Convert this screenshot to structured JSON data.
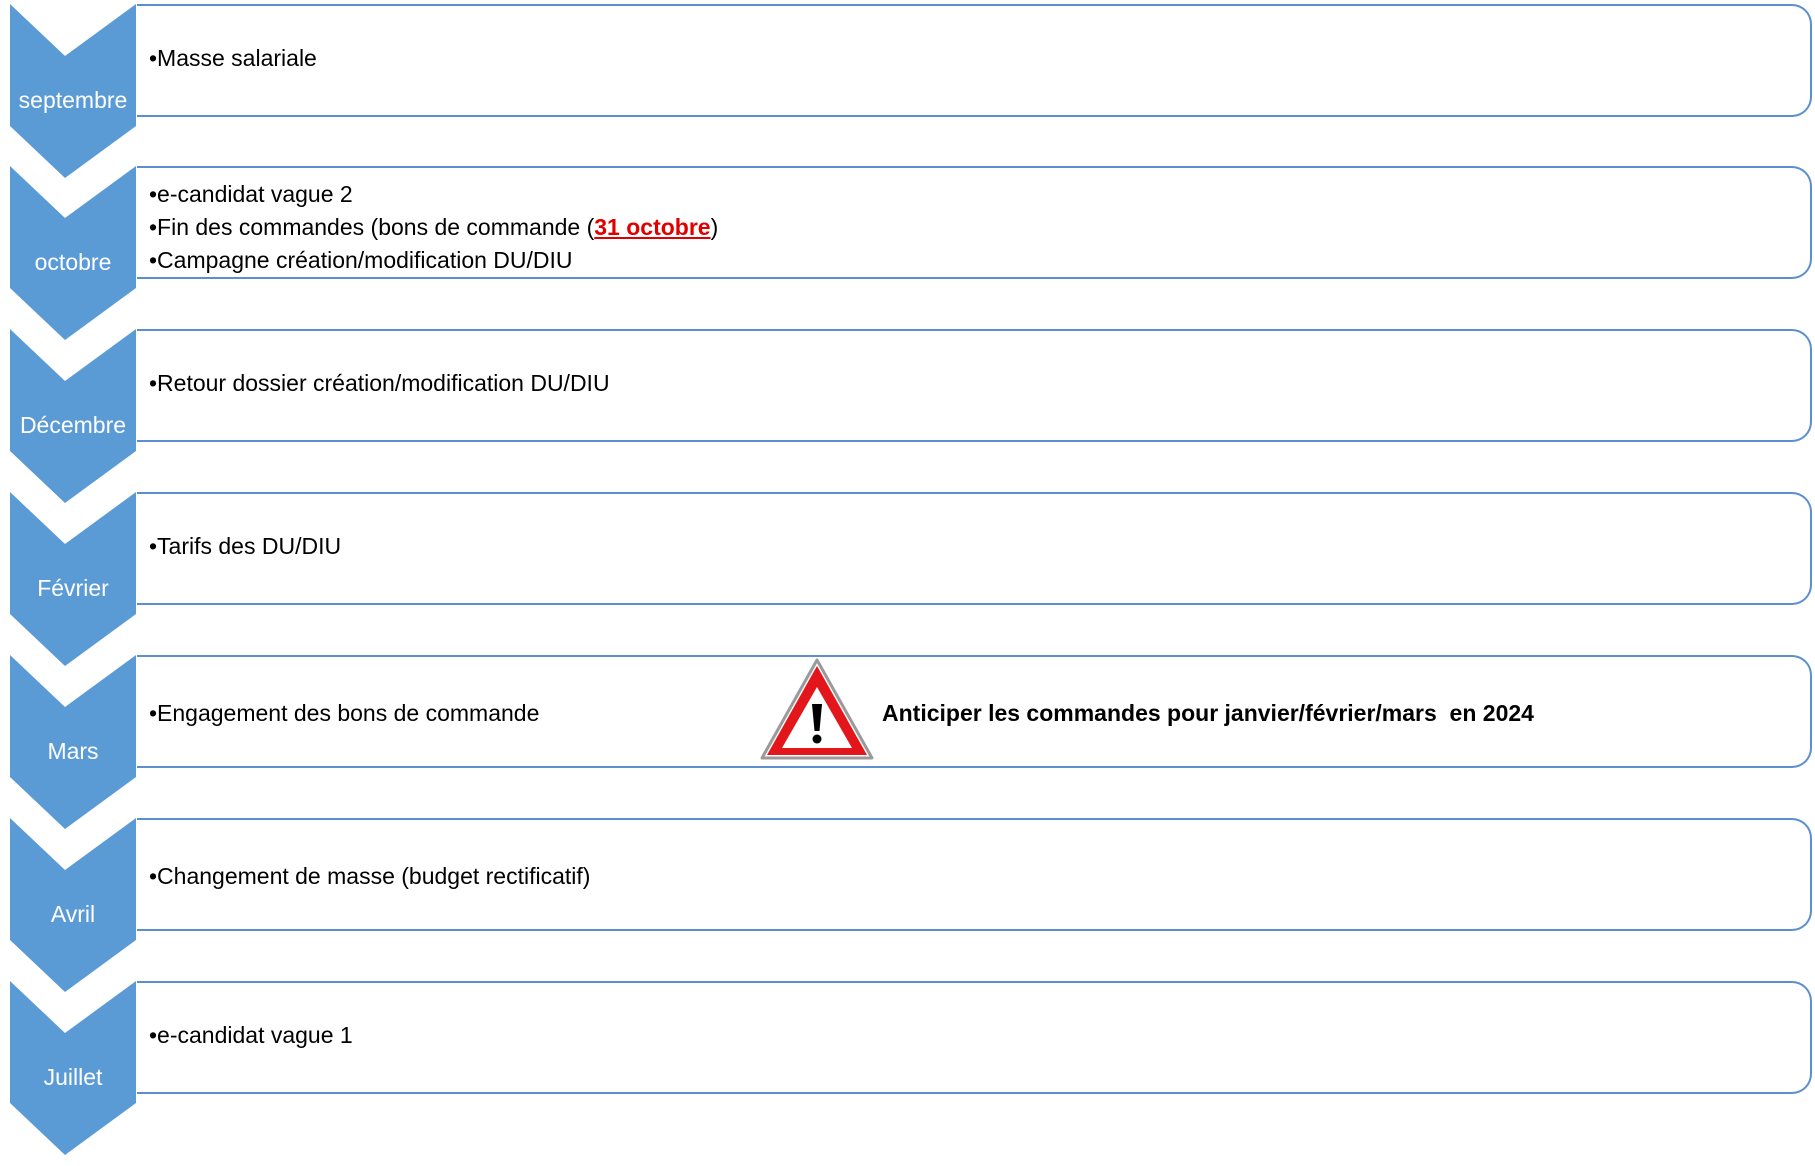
{
  "colors": {
    "chevron_fill": "#5b9bd5",
    "box_border": "#5b8fd0",
    "highlight": "#e00000",
    "warning_red": "#e3161b"
  },
  "rows": [
    {
      "month": "septembre",
      "items": [
        {
          "prefix": "•Masse salariale"
        }
      ]
    },
    {
      "month": "octobre",
      "items": [
        {
          "prefix": "•e-candidat vague 2"
        },
        {
          "prefix": "•Fin des commandes (bons de commande (",
          "highlight": "31 octobre",
          "suffix": ")"
        },
        {
          "prefix": "•Campagne création/modification DU/DIU"
        }
      ]
    },
    {
      "month": "Décembre",
      "items": [
        {
          "prefix": "•Retour dossier création/modification DU/DIU"
        }
      ]
    },
    {
      "month": "Février",
      "items": [
        {
          "prefix": "•Tarifs des DU/DIU"
        }
      ]
    },
    {
      "month": "Mars",
      "items": [
        {
          "prefix": "•Engagement des bons de commande"
        }
      ],
      "warning": {
        "icon": "warning-triangle-icon",
        "text": "Anticiper les commandes pour janvier/février/mars  en 2024"
      }
    },
    {
      "month": "Avril",
      "items": [
        {
          "prefix": "•Changement de masse (budget rectificatif)"
        }
      ]
    },
    {
      "month": "Juillet",
      "items": [
        {
          "prefix": "•e-candidat vague 1"
        }
      ]
    }
  ]
}
